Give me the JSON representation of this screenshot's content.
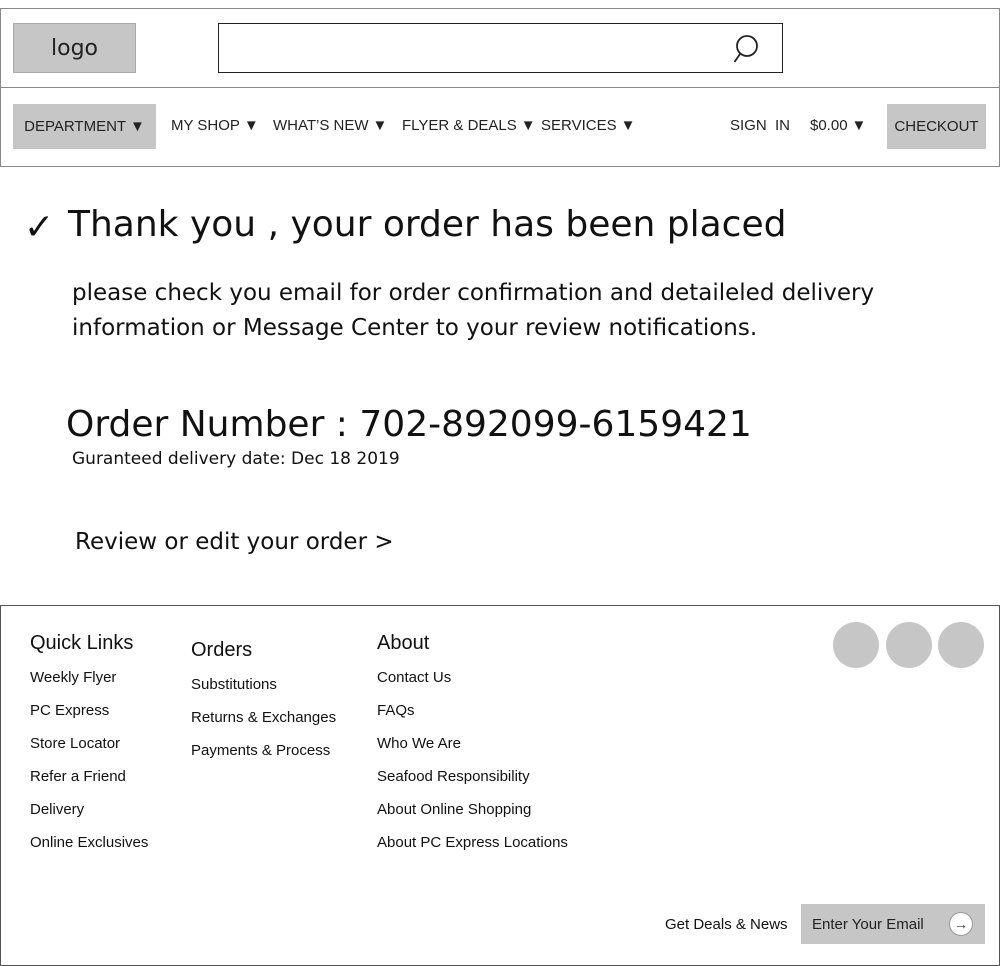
{
  "header": {
    "logo": "logo",
    "search": {
      "value": "",
      "placeholder": "",
      "icon": "search-icon"
    }
  },
  "nav": {
    "department": "DEPARTMENT ▼",
    "items": [
      {
        "label": "MY SHOP",
        "arrow": "▼"
      },
      {
        "label": "WHAT’S NEW",
        "arrow": "▼"
      },
      {
        "label": "FLYER & DEALS",
        "arrow": "▼"
      },
      {
        "label": "SERVICES",
        "arrow": "▼"
      }
    ],
    "sign_in": "SIGN  IN",
    "cart_total": "$0.00",
    "cart_arrow": "▼",
    "checkout": "CHECKOUT"
  },
  "confirmation": {
    "check_glyph": "✓",
    "title": "Thank you , your order has been placed",
    "message": "please check you email for order confirmation and detaileled delivery information or Message Center to your review notifications.",
    "order_number": "Order Number : 702-892099-6159421",
    "delivery": "Guranteed delivery date: Dec 18 2019",
    "review_link": "Review or edit your order >"
  },
  "footer": {
    "quick_links": {
      "heading": "Quick Links",
      "links": [
        "Weekly Flyer",
        "PC Express",
        "Store Locator",
        "Refer a Friend",
        "Delivery",
        "Online Exclusives"
      ]
    },
    "orders": {
      "heading": "Orders",
      "links": [
        "Substitutions",
        "Returns & Exchanges",
        "Payments & Process"
      ]
    },
    "about": {
      "heading": "About",
      "links": [
        "Contact Us",
        "FAQs",
        "Who We Are",
        "Seafood Responsibility",
        "About Online Shopping",
        "About PC Express Locations"
      ]
    },
    "newsletter": {
      "label": "Get Deals & News",
      "placeholder": "Enter Your Email",
      "button_glyph": "→"
    },
    "colors": {
      "placeholder_gray": "#c6c6c6"
    }
  }
}
